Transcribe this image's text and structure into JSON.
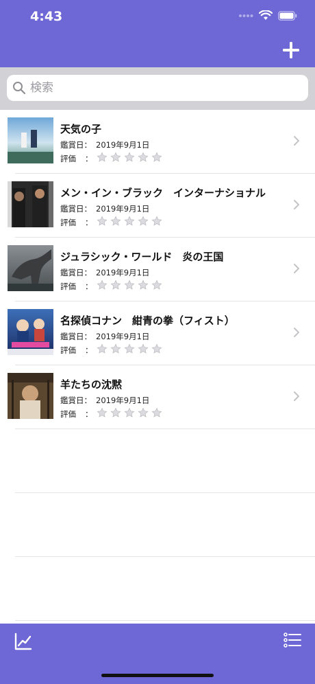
{
  "status_bar": {
    "time": "4:43"
  },
  "nav": {
    "add_icon": "plus-icon"
  },
  "search": {
    "placeholder": "検索",
    "value": ""
  },
  "movies": [
    {
      "title": "天気の子",
      "date_label": "鑑賞日：",
      "date": "2019年9月1日",
      "rating_label": "評価",
      "rating_colon": "：",
      "rating": 0,
      "rating_max": 5
    },
    {
      "title": "メン・イン・ブラック　インターナショナル",
      "date_label": "鑑賞日：",
      "date": "2019年9月1日",
      "rating_label": "評価",
      "rating_colon": "：",
      "rating": 0,
      "rating_max": 5
    },
    {
      "title": "ジュラシック・ワールド　炎の王国",
      "date_label": "鑑賞日：",
      "date": "2019年9月1日",
      "rating_label": "評価",
      "rating_colon": "：",
      "rating": 0,
      "rating_max": 5
    },
    {
      "title": "名探偵コナン　紺青の拳（フィスト）",
      "date_label": "鑑賞日：",
      "date": "2019年9月1日",
      "rating_label": "評価",
      "rating_colon": "：",
      "rating": 0,
      "rating_max": 5
    },
    {
      "title": "羊たちの沈黙",
      "date_label": "鑑賞日：",
      "date": "2019年9月1日",
      "rating_label": "評価",
      "rating_colon": "：",
      "rating": 0,
      "rating_max": 5
    }
  ],
  "tabbar": {
    "left_icon": "chart-icon",
    "right_icon": "list-icon"
  },
  "colors": {
    "accent": "#6e68d6",
    "search_bg": "#d2d2d6",
    "star_empty": "#c8c8cc"
  }
}
